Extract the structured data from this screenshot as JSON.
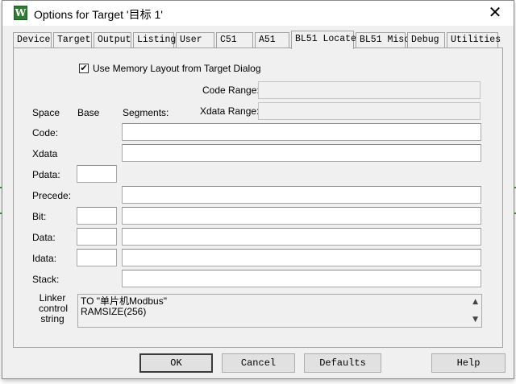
{
  "window": {
    "title": "Options for Target '目标 1'",
    "icon_letter": "W",
    "close_symbol": "✕"
  },
  "tabs": [
    {
      "label": "Device",
      "active": false
    },
    {
      "label": "Target",
      "active": false
    },
    {
      "label": "Output",
      "active": false
    },
    {
      "label": "Listing",
      "active": false
    },
    {
      "label": "User",
      "active": false
    },
    {
      "label": "C51",
      "active": false
    },
    {
      "label": "A51",
      "active": false
    },
    {
      "label": "BL51 Locate",
      "active": true
    },
    {
      "label": "BL51 Misc",
      "active": false
    },
    {
      "label": "Debug",
      "active": false
    },
    {
      "label": "Utilities",
      "active": false
    }
  ],
  "locate": {
    "use_memory_layout": {
      "label": "Use Memory Layout from Target Dialog",
      "checked": true,
      "check_glyph": "✔"
    },
    "code_range": {
      "label": "Code Range:",
      "value": ""
    },
    "xdata_range": {
      "label": "Xdata Range:",
      "value": ""
    },
    "headers": {
      "space": "Space",
      "base": "Base",
      "segments": "Segments:"
    },
    "rows": {
      "code": {
        "label": "Code:",
        "segments": ""
      },
      "xdata": {
        "label": "Xdata",
        "segments": ""
      },
      "pdata": {
        "label": "Pdata:",
        "base": ""
      },
      "precede": {
        "label": "Precede:",
        "segments": ""
      },
      "bit": {
        "label": "Bit:",
        "base": "",
        "segments": ""
      },
      "data": {
        "label": "Data:",
        "base": "",
        "segments": ""
      },
      "idata": {
        "label": "Idata:",
        "base": "",
        "segments": ""
      },
      "stack": {
        "label": "Stack:",
        "segments": ""
      }
    },
    "linker": {
      "label_lines": [
        "Linker",
        "control",
        "string"
      ],
      "lines": [
        "TO \"单片机Modbus\"",
        "RAMSIZE(256)"
      ],
      "scroll_up": "▲",
      "scroll_down": "▼"
    }
  },
  "buttons": {
    "ok": "OK",
    "cancel": "Cancel",
    "defaults": "Defaults",
    "help": "Help"
  }
}
